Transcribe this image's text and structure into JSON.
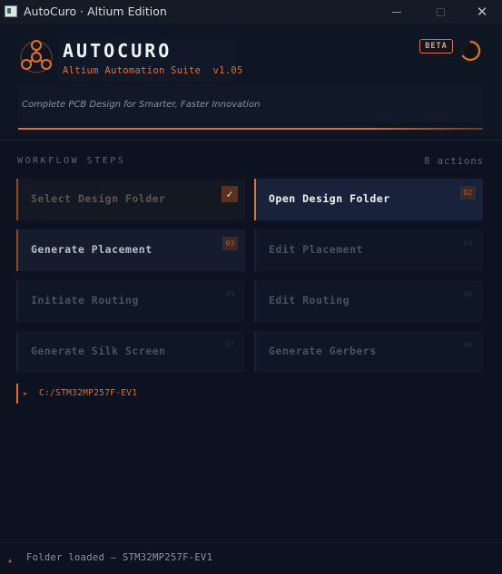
{
  "window": {
    "title": "AutoCuro · Altium Edition",
    "minimize_label": "",
    "close_label": "✕"
  },
  "header": {
    "app_name": "AUTOCURO",
    "subtitle": "Altium Automation Suite  v1.05",
    "badge": "BETA",
    "tagline": "Complete PCB Design for Smarter, Faster Innovation"
  },
  "workflow": {
    "heading": "WORKFLOW STEPS",
    "count": "8 actions",
    "steps": [
      {
        "label": "Select Design Folder",
        "number": "✓",
        "state": "done"
      },
      {
        "label": "Open Design Folder",
        "number": "02",
        "state": "active"
      },
      {
        "label": "Generate Placement",
        "number": "03",
        "state": "ready"
      },
      {
        "label": "Edit Placement",
        "number": "04",
        "state": "disabled"
      },
      {
        "label": "Initiate Routing",
        "number": "05",
        "state": "disabled"
      },
      {
        "label": "Edit Routing",
        "number": "06",
        "state": "disabled"
      },
      {
        "label": "Generate Silk Screen",
        "number": "07",
        "state": "disabled"
      },
      {
        "label": "Generate Gerbers",
        "number": "08",
        "state": "disabled"
      }
    ]
  },
  "path": {
    "arrow": "►",
    "value": "C:/STM32MP257F-EV1"
  },
  "status": {
    "dot": "▲",
    "text": "Folder loaded — STM32MP257F-EV1"
  },
  "colors": {
    "accent": "#e2702c",
    "background": "#0c1220",
    "panel": "#111827"
  }
}
